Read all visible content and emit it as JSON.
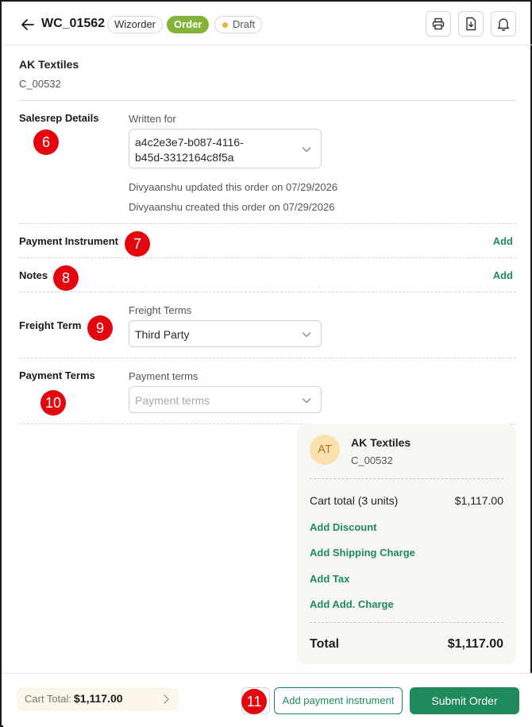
{
  "header": {
    "order_id": "WC_01562",
    "source_chip": "Wizorder",
    "type_chip": "Order",
    "status_chip": "Draft",
    "colors": {
      "order_chip": "#84b33a",
      "draft_dot": "#f2b233"
    }
  },
  "customer": {
    "name": "AK Textiles",
    "code": "C_00532"
  },
  "salesrep": {
    "title": "Salesrep Details",
    "field_label": "Written for",
    "value_line1": "a4c2e3e7-b087-4116-",
    "value_line2": "b45d-3312164c8f5a",
    "updated_note": "Divyaanshu updated this order on 07/29/2026",
    "created_note": "Divyaanshu created this order on 07/29/2026"
  },
  "payment_instrument": {
    "title": "Payment Instrument",
    "action": "Add"
  },
  "notes": {
    "title": "Notes",
    "action": "Add"
  },
  "freight": {
    "title": "Freight Term",
    "field_label": "Freight Terms",
    "value": "Third Party"
  },
  "payment_terms": {
    "title": "Payment Terms",
    "field_label": "Payment terms",
    "placeholder": "Payment terms"
  },
  "badges": [
    "6",
    "7",
    "8",
    "9",
    "10",
    "11"
  ],
  "summary": {
    "avatar": "AT",
    "name": "AK Textiles",
    "code": "C_00532",
    "cart_label": "Cart total (3 units)",
    "cart_value": "$1,117.00",
    "links": [
      "Add Discount",
      "Add Shipping Charge",
      "Add Tax",
      "Add Add. Charge"
    ],
    "total_label": "Total",
    "total_value": "$1,117.00"
  },
  "footer": {
    "cart_label": "Cart Total:",
    "cart_value": "$1,117.00",
    "secondary_button": "Add payment instrument",
    "primary_button": "Submit Order",
    "accent_color": "#1f8a5c"
  }
}
